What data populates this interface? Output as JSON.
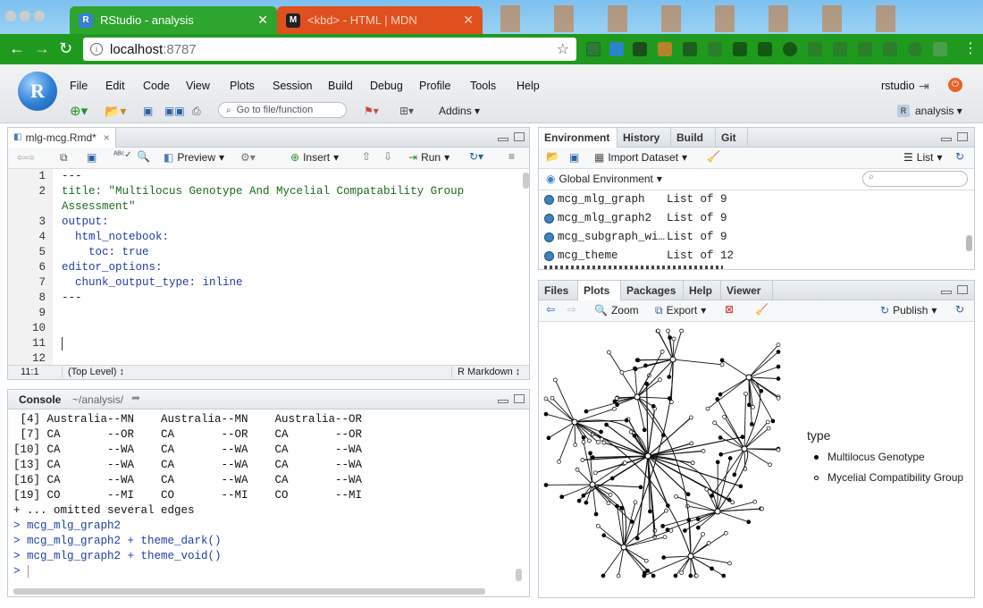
{
  "browser": {
    "tabs": [
      {
        "title": "RStudio - analysis"
      },
      {
        "title": "<kbd> - HTML | MDN"
      }
    ],
    "url_host": "localhost",
    "url_port": ":8787"
  },
  "rstudio": {
    "menu": [
      "File",
      "Edit",
      "Code",
      "View",
      "Plots",
      "Session",
      "Build",
      "Debug",
      "Profile",
      "Tools",
      "Help"
    ],
    "user": "rstudio",
    "goto_placeholder": "Go to file/function",
    "addins": "Addins",
    "project": "analysis"
  },
  "editor": {
    "tab": "mlg-mcg.Rmd*",
    "toolbar": {
      "preview": "Preview",
      "insert": "Insert",
      "run": "Run"
    },
    "lines": [
      {
        "n": "1",
        "t": "---",
        "c": "#222"
      },
      {
        "n": "2",
        "t": "title: \"Multilocus Genotype And Mycelial Compatability Group",
        "c": "#1a6b1a"
      },
      {
        "n": "",
        "t": "Assessment\"",
        "c": "#1a6b1a"
      },
      {
        "n": "3",
        "t": "output:",
        "c": "#1c3fa8"
      },
      {
        "n": "4",
        "t": "  html_notebook:",
        "c": "#1c3fa8"
      },
      {
        "n": "5",
        "t": "    toc: true",
        "c": "#1c3fa8"
      },
      {
        "n": "6",
        "t": "editor_options:",
        "c": "#1c3fa8"
      },
      {
        "n": "7",
        "t": "  chunk_output_type: inline",
        "c": "#1c3fa8"
      },
      {
        "n": "8",
        "t": "---",
        "c": "#222"
      },
      {
        "n": "9",
        "t": "",
        "c": "#222"
      },
      {
        "n": "10",
        "t": "",
        "c": "#222"
      },
      {
        "n": "11",
        "t": "",
        "c": "#222"
      },
      {
        "n": "12",
        "t": "",
        "c": "#222"
      }
    ],
    "status_pos": "11:1",
    "status_scope": "(Top Level) ↕",
    "status_mode": "R Markdown ↕"
  },
  "console": {
    "title": "Console",
    "path": "~/analysis/",
    "lines": [
      {
        "t": " [4] Australia--MN    Australia--MN    Australia--OR",
        "c": "#111"
      },
      {
        "t": " [7] CA       --OR    CA       --OR    CA       --OR",
        "c": "#111"
      },
      {
        "t": "[10] CA       --WA    CA       --WA    CA       --WA",
        "c": "#111"
      },
      {
        "t": "[13] CA       --WA    CA       --WA    CA       --WA",
        "c": "#111"
      },
      {
        "t": "[16] CA       --WA    CA       --WA    CA       --WA",
        "c": "#111"
      },
      {
        "t": "[19] CO       --MI    CO       --MI    CO       --MI",
        "c": "#111"
      },
      {
        "t": "+ ... omitted several edges",
        "c": "#111"
      },
      {
        "t": "> mcg_mlg_graph2",
        "c": "#1c3fa8"
      },
      {
        "t": "> mcg_mlg_graph2 + theme_dark()",
        "c": "#1c3fa8"
      },
      {
        "t": "> mcg_mlg_graph2 + theme_void()",
        "c": "#1c3fa8"
      },
      {
        "t": "> ",
        "c": "#1c3fa8"
      }
    ]
  },
  "environment": {
    "tabs": [
      "Environment",
      "History",
      "Build",
      "Git"
    ],
    "import_label": "Import Dataset",
    "list_label": "List",
    "scope": "Global Environment",
    "rows": [
      {
        "name": "mcg_mlg_graph",
        "value": "List of 9"
      },
      {
        "name": "mcg_mlg_graph2",
        "value": "List of 9"
      },
      {
        "name": "mcg_subgraph_wi…",
        "value": "List of 9"
      },
      {
        "name": "mcg_theme",
        "value": "List of 12"
      }
    ]
  },
  "files": {
    "tabs": [
      "Files",
      "Plots",
      "Packages",
      "Help",
      "Viewer"
    ],
    "zoom": "Zoom",
    "export": "Export",
    "publish": "Publish",
    "legend_title": "type",
    "legend_items": [
      "Multilocus Genotype",
      "Mycelial Compatibility Group"
    ]
  }
}
